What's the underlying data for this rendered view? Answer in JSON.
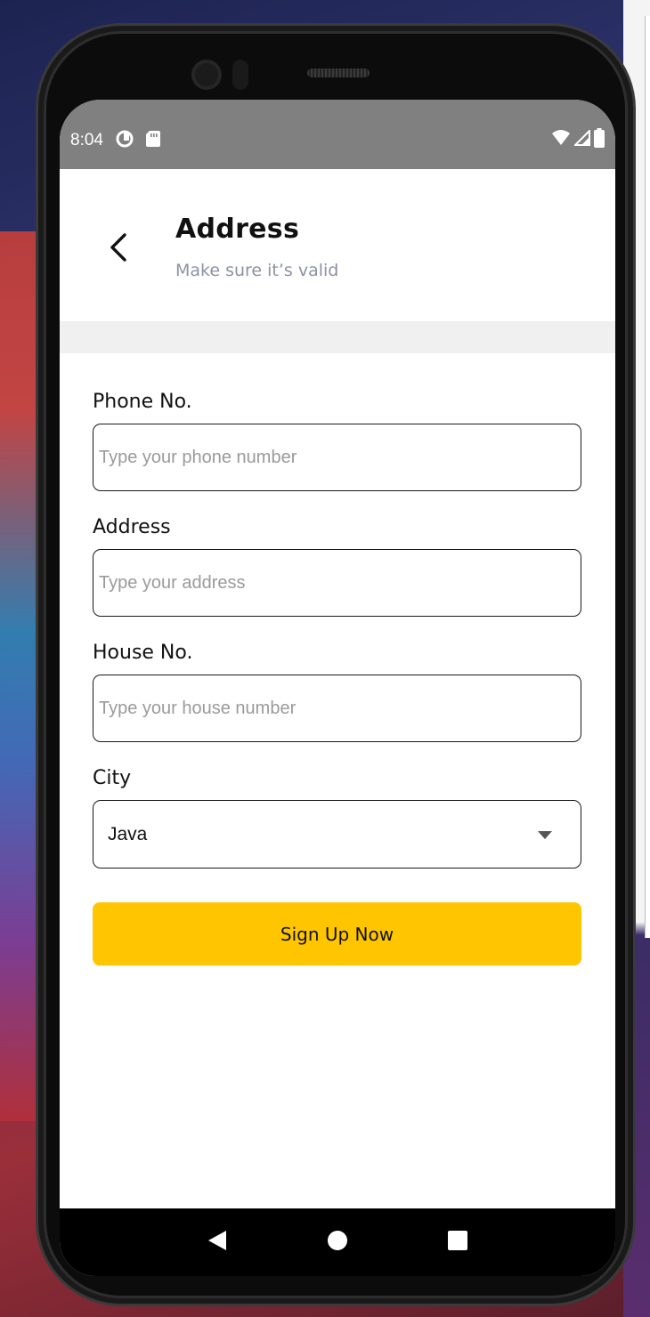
{
  "status_bar": {
    "time": "8:04",
    "left_icons": [
      "data-saver-icon",
      "sd-card-icon"
    ],
    "right_icons": [
      "wifi-icon",
      "signal-icon",
      "battery-icon"
    ]
  },
  "header": {
    "title": "Address",
    "subtitle": "Make sure it’s valid"
  },
  "form": {
    "phone": {
      "label": "Phone No.",
      "placeholder": "Type your phone number",
      "value": ""
    },
    "address": {
      "label": "Address",
      "placeholder": "Type your address",
      "value": ""
    },
    "house": {
      "label": "House No.",
      "placeholder": "Type your house number",
      "value": ""
    },
    "city": {
      "label": "City",
      "selected": "Java"
    },
    "submit_label": "Sign Up Now"
  },
  "colors": {
    "accent": "#FFC600",
    "subtitle": "#8D92A3",
    "status_bar": "#808080"
  },
  "nav_bar": {
    "buttons": [
      "back-triangle-icon",
      "home-circle-icon",
      "recents-square-icon"
    ]
  }
}
